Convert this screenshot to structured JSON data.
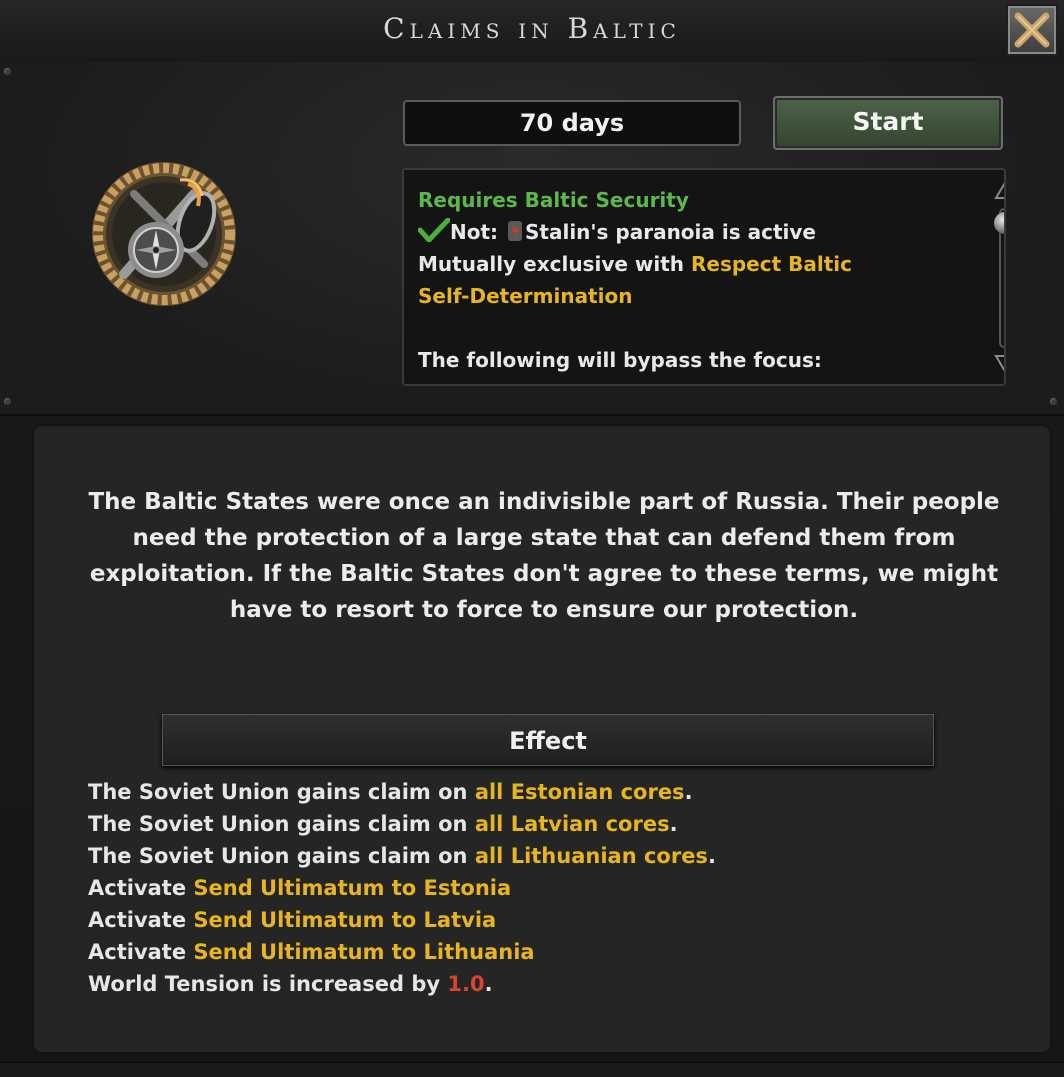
{
  "window": {
    "title": "Claims in Baltic",
    "close_icon": "close-x-icon"
  },
  "focus": {
    "emblem_icon": "compass-laurel-emblem-icon",
    "duration": "70 days",
    "start_label": "Start"
  },
  "requirements": {
    "requires": "Requires Baltic Security",
    "not_prefix": "Not: ",
    "not_text": "Stalin's paranoia is active",
    "mutual_prefix": "Mutually exclusive with ",
    "mutual_link_1": "Respect Baltic",
    "mutual_link_2": "Self-Determination",
    "bypass": "The following will bypass the focus:"
  },
  "description": "The Baltic States were once an indivisible part of Russia. Their people need the protection of a large state that can defend them from exploitation. If the Baltic States don't agree to these terms, we might have to resort to force to ensure our protection.",
  "effect": {
    "header": "Effect",
    "claim_prefix": "The Soviet Union gains claim on ",
    "claims": [
      "all Estonian cores",
      "all Latvian cores",
      "all Lithuanian cores"
    ],
    "activate_prefix": "Activate ",
    "activations": [
      "Send Ultimatum to Estonia",
      "Send Ultimatum to Latvia",
      "Send Ultimatum to Lithuania"
    ],
    "tension_prefix": "World Tension is increased by ",
    "tension_value": "1.0",
    "period": "."
  },
  "colors": {
    "green": "#5cb84a",
    "yellow": "#e7b520",
    "red": "#d9452c",
    "start_button": "#3f5339"
  }
}
